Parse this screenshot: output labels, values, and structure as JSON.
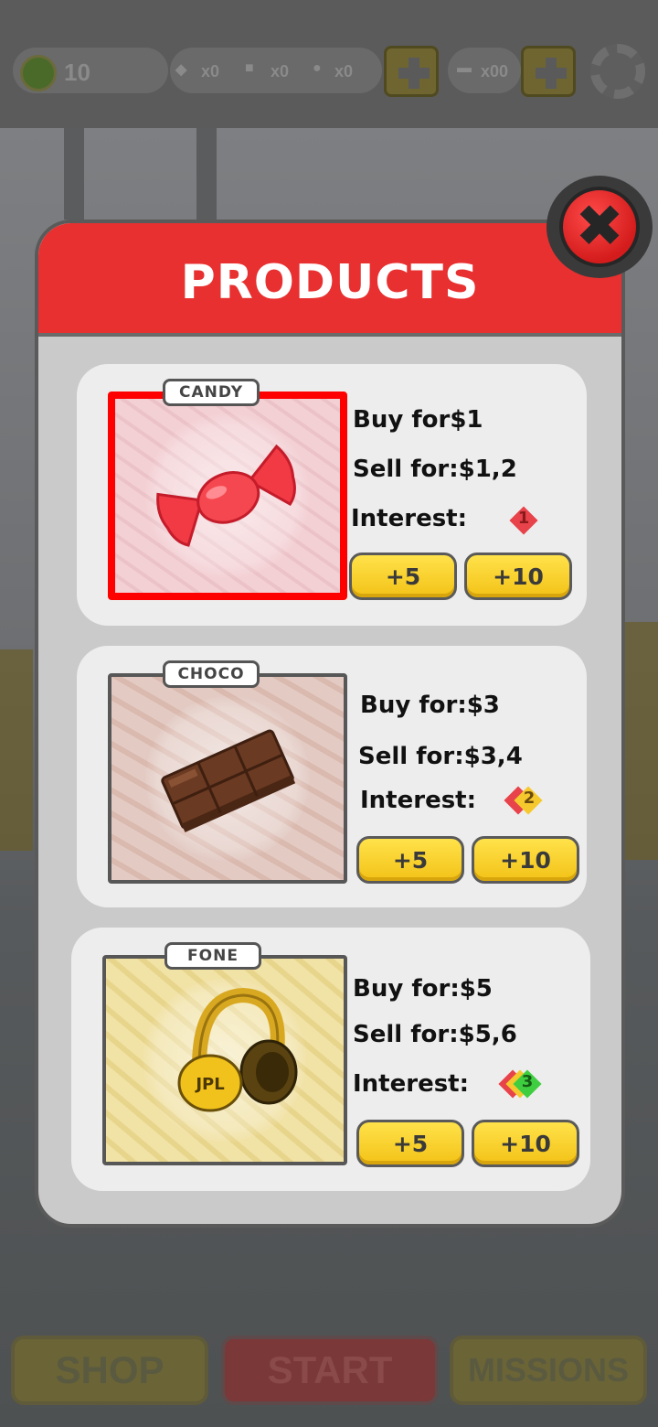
{
  "hud": {
    "money": "10",
    "item1_count": "x0",
    "item2_count": "x0",
    "item3_count": "x0",
    "cash": "x00"
  },
  "popup": {
    "title": "PRODUCTS",
    "close_icon": "✖"
  },
  "products": [
    {
      "tag": "CANDY",
      "buy": "Buy for$1",
      "sell": "Sell for:$1,2",
      "interest_label": "Interest:",
      "interest_level": "1",
      "plus5": "+5",
      "plus10": "+10"
    },
    {
      "tag": "CHOCO",
      "buy": "Buy for:$3",
      "sell": "Sell for:$3,4",
      "interest_label": "Interest:",
      "interest_level": "2",
      "plus5": "+5",
      "plus10": "+10"
    },
    {
      "tag": "FONE",
      "buy": "Buy for:$5",
      "sell": "Sell for:$5,6",
      "interest_label": "Interest:",
      "interest_level": "3",
      "plus5": "+5",
      "plus10": "+10"
    }
  ],
  "headphone_logo": "JPL",
  "bottom_nav": {
    "shop": "SHOP",
    "start": "START",
    "missions": "MISSIONS"
  },
  "colors": {
    "header_red": "#e83030",
    "button_yellow": "#f3c217",
    "selected_border": "#ff0000"
  },
  "icons": {
    "close": "close-icon",
    "settings": "gear-icon",
    "money": "coin-icon"
  }
}
